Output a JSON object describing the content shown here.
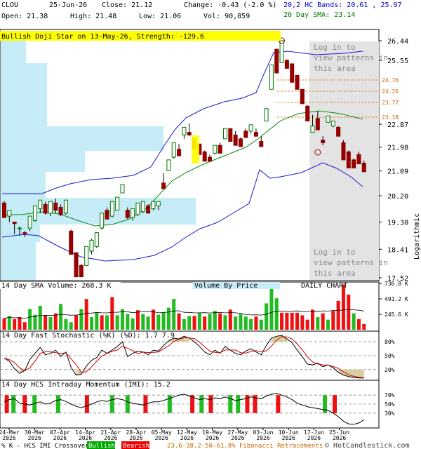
{
  "header": {
    "symbol": "CLOU",
    "date": "25-Jun-26",
    "close_label": "Close: 21.12",
    "change_label": "Change: -0.43 (-2.0 %)",
    "open_label": "Open: 21.38",
    "high_label": "High: 21.48",
    "low_label": "Low: 21.06",
    "vol_label": "Vol: 90,859",
    "bands_label": "20,2 HC Bands: 20.61 , 25.97",
    "sma_label": "20 Day SMA: 23.14"
  },
  "chart_data": {
    "type": "candlestick",
    "pattern_banner": "Bullish Doji Star on 13-May-26, Strength: -129.6",
    "overlay_note": "Log in to view patterns in this area",
    "scale_label": "Logarithmic",
    "price_ticks": [
      "26.44",
      "25.55",
      "22.87",
      "21.98",
      "21.09",
      "20.20",
      "19.30",
      "18.41",
      "17.52"
    ],
    "fib_levels": [
      "24.76",
      "24.26",
      "23.77",
      "23.18"
    ],
    "volume_title": "14 Day SMA Volume: 268.3 K",
    "volume_by_price_label": "Volume By Price",
    "daily_chart_label": "DAILY CHART",
    "volume_ticks": [
      "736.8 K",
      "491.2 K",
      "245.6 K"
    ],
    "stochastic_title": "14 Day Fast Stochastic (%K) (%D): 1.7   7.9",
    "stochastic_ticks": [
      "80%",
      "50%",
      "20%"
    ],
    "imi_title": "14 Day HCS Intraday Momentum (IMI): 15.2",
    "imi_ticks": [
      "70%",
      "50%",
      "30%"
    ],
    "x_dates": [
      [
        "24-Mar",
        "2026"
      ],
      [
        "30-Mar",
        "2026"
      ],
      [
        "07-Apr",
        "2026"
      ],
      [
        "14-Apr",
        "2026"
      ],
      [
        "21-Apr",
        "2026"
      ],
      [
        "28-Apr",
        "2026"
      ],
      [
        "05-May",
        "2026"
      ],
      [
        "12-May",
        "2026"
      ],
      [
        "19-May",
        "2026"
      ],
      [
        "27-May",
        "2026"
      ],
      [
        "03-Jun",
        "2026"
      ],
      [
        "10-Jun",
        "2026"
      ],
      [
        "17-Jun",
        "2026"
      ],
      [
        "25-Jun",
        "2026"
      ]
    ],
    "footer": {
      "crossover": "% K - HCS IMI Crossover:",
      "bullish": "Bullish",
      "bearish": "Bearish",
      "fib": "23.6-38.2-50-61.8% Fibonacci Retracements",
      "copyright": "© HotCandlestick.com"
    },
    "candles": [
      [
        19.95,
        20.02,
        19.5,
        19.45
      ],
      [
        19.5,
        19.65,
        19.3,
        19.7
      ],
      [
        19.3,
        19.2,
        18.9,
        19.25
      ],
      [
        19.1,
        19.15,
        18.85,
        19.1
      ],
      [
        18.95,
        19.0,
        18.8,
        18.9
      ],
      [
        19.1,
        19.35,
        19.0,
        19.5
      ],
      [
        19.35,
        19.8,
        19.3,
        19.85
      ],
      [
        19.75,
        20.0,
        19.6,
        20.05
      ],
      [
        19.9,
        20.0,
        19.55,
        19.6
      ],
      [
        19.6,
        19.95,
        19.5,
        20.0
      ],
      [
        19.95,
        20.1,
        19.6,
        19.7
      ],
      [
        19.8,
        19.9,
        19.5,
        19.55
      ],
      [
        19.6,
        19.95,
        19.55,
        20.05
      ],
      [
        19.0,
        19.05,
        18.3,
        18.25
      ],
      [
        18.3,
        18.3,
        17.65,
        17.55
      ],
      [
        17.9,
        17.95,
        17.6,
        17.55
      ],
      [
        17.9,
        18.45,
        17.9,
        18.5
      ],
      [
        18.35,
        18.75,
        18.25,
        18.7
      ],
      [
        18.5,
        18.9,
        18.45,
        18.95
      ],
      [
        19.1,
        19.55,
        19.05,
        19.6
      ],
      [
        19.7,
        19.8,
        19.45,
        19.4
      ],
      [
        19.5,
        19.95,
        19.45,
        20.0
      ],
      [
        19.7,
        20.05,
        19.7,
        20.15
      ],
      [
        20.3,
        20.5,
        20.35,
        20.6
      ],
      [
        19.7,
        19.8,
        19.4,
        19.45
      ],
      [
        19.45,
        19.7,
        19.35,
        19.75
      ],
      [
        19.55,
        19.85,
        19.5,
        19.95
      ],
      [
        19.65,
        19.95,
        19.6,
        20.0
      ],
      [
        19.85,
        19.9,
        19.7,
        19.6
      ],
      [
        19.75,
        19.95,
        19.7,
        20.0
      ],
      [
        19.85,
        19.95,
        19.7,
        20.0
      ],
      [
        20.65,
        21.0,
        20.5,
        20.45
      ],
      [
        21.1,
        21.45,
        21.1,
        21.5
      ],
      [
        21.6,
        22.1,
        21.55,
        22.15
      ],
      [
        21.9,
        22.1,
        21.7,
        21.65
      ],
      [
        22.45,
        22.7,
        22.3,
        22.75
      ],
      [
        22.55,
        22.9,
        22.4,
        22.45
      ],
      [
        22.3,
        22.35,
        22.0,
        21.9
      ],
      [
        22.1,
        22.05,
        21.7,
        21.7
      ],
      [
        21.8,
        21.85,
        21.5,
        21.45
      ],
      [
        21.6,
        21.7,
        21.5,
        21.45
      ],
      [
        21.75,
        22.0,
        21.7,
        22.05
      ],
      [
        22.05,
        22.15,
        21.85,
        21.75
      ],
      [
        22.3,
        22.6,
        22.4,
        22.7
      ],
      [
        22.7,
        22.65,
        22.25,
        22.2
      ],
      [
        22.45,
        22.6,
        22.1,
        22.05
      ],
      [
        22.3,
        22.35,
        22.1,
        22.0
      ],
      [
        22.6,
        22.7,
        22.4,
        22.35
      ],
      [
        22.6,
        22.75,
        22.5,
        22.85
      ],
      [
        22.55,
        22.7,
        22.45,
        22.4
      ],
      [
        22.2,
        22.4,
        22.15,
        22.0
      ],
      [
        23.0,
        23.35,
        23.1,
        23.5
      ],
      [
        24.3,
        25.1,
        24.4,
        25.35
      ],
      [
        26.05,
        26.05,
        25.1,
        25.0
      ],
      [
        25.45,
        25.7,
        25.55,
        26.44
      ],
      [
        25.55,
        25.6,
        25.2,
        25.2
      ],
      [
        25.4,
        25.4,
        24.9,
        24.6
      ],
      [
        24.9,
        24.65,
        24.4,
        24.3
      ],
      [
        24.3,
        24.1,
        23.85,
        23.7
      ],
      [
        23.6,
        23.65,
        23.25,
        23.0
      ],
      [
        22.55,
        23.25,
        22.55,
        22.8
      ],
      [
        23.1,
        23.4,
        22.9,
        22.65
      ],
      [
        22.25,
        22.4,
        22.05,
        22.15
      ],
      [
        22.95,
        23.2,
        23.0,
        23.2
      ],
      [
        22.8,
        22.85,
        22.75,
        23.0
      ],
      [
        22.75,
        22.8,
        22.45,
        22.4
      ],
      [
        22.15,
        22.25,
        21.55,
        21.5
      ],
      [
        21.8,
        21.85,
        21.35,
        21.2
      ],
      [
        21.5,
        21.55,
        21.3,
        21.2
      ],
      [
        21.7,
        21.8,
        21.4,
        21.35
      ],
      [
        21.38,
        21.48,
        21.12,
        21.06
      ]
    ],
    "volumes": [
      [
        180000,
        "red"
      ],
      [
        220000,
        "green"
      ],
      [
        170000,
        "red"
      ],
      [
        200000,
        "red"
      ],
      [
        120000,
        "red"
      ],
      [
        330000,
        "green"
      ],
      [
        240000,
        "green"
      ],
      [
        380000,
        "green"
      ],
      [
        230000,
        "red"
      ],
      [
        200000,
        "green"
      ],
      [
        260000,
        "red"
      ],
      [
        410000,
        "green"
      ],
      [
        170000,
        "green"
      ],
      [
        120000,
        "green"
      ],
      [
        230000,
        "red"
      ],
      [
        330000,
        "green"
      ],
      [
        490000,
        "red"
      ],
      [
        200000,
        "green"
      ],
      [
        270000,
        "green"
      ],
      [
        230000,
        "red"
      ],
      [
        230000,
        "green"
      ],
      [
        520000,
        "red"
      ],
      [
        230000,
        "green"
      ],
      [
        330000,
        "green"
      ],
      [
        250000,
        "green"
      ],
      [
        180000,
        "green"
      ],
      [
        310000,
        "red"
      ],
      [
        250000,
        "green"
      ],
      [
        210000,
        "green"
      ],
      [
        320000,
        "red"
      ],
      [
        240000,
        "green"
      ],
      [
        280000,
        "green"
      ],
      [
        350000,
        "green"
      ],
      [
        490000,
        "green"
      ],
      [
        260000,
        "red"
      ],
      [
        170000,
        "green"
      ],
      [
        220000,
        "green"
      ],
      [
        220000,
        "red"
      ],
      [
        270000,
        "green"
      ],
      [
        210000,
        "red"
      ],
      [
        250000,
        "green"
      ],
      [
        300000,
        "green"
      ],
      [
        260000,
        "red"
      ],
      [
        230000,
        "green"
      ],
      [
        320000,
        "red"
      ],
      [
        210000,
        "green"
      ],
      [
        250000,
        "green"
      ],
      [
        210000,
        "green"
      ],
      [
        170000,
        "green"
      ],
      [
        210000,
        "red"
      ],
      [
        160000,
        "green"
      ],
      [
        420000,
        "green"
      ],
      [
        660000,
        "green"
      ],
      [
        500000,
        "green"
      ],
      [
        270000,
        "red"
      ],
      [
        270000,
        "red"
      ],
      [
        270000,
        "red"
      ],
      [
        270000,
        "red"
      ],
      [
        230000,
        "red"
      ],
      [
        160000,
        "red"
      ],
      [
        320000,
        "red"
      ],
      [
        200000,
        "green"
      ],
      [
        260000,
        "red"
      ],
      [
        160000,
        "green"
      ],
      [
        300000,
        "red"
      ],
      [
        460000,
        "red"
      ],
      [
        720000,
        "red"
      ],
      [
        560000,
        "red"
      ],
      [
        260000,
        "green"
      ],
      [
        170000,
        "red"
      ],
      [
        90859,
        "red"
      ]
    ],
    "imi_bars": [
      [
        0.5,
        "red"
      ],
      [
        1.8,
        "green"
      ],
      [
        4.0,
        "red"
      ],
      [
        5.9,
        "green"
      ],
      [
        10.5,
        "green"
      ],
      [
        16.1,
        "red"
      ],
      [
        21.0,
        "green"
      ],
      [
        24.0,
        "green"
      ],
      [
        27.5,
        "red"
      ],
      [
        32.2,
        "green"
      ],
      [
        36.6,
        "red"
      ],
      [
        38.4,
        "green"
      ],
      [
        40.2,
        "red"
      ],
      [
        44.0,
        "green"
      ],
      [
        45.5,
        "green"
      ],
      [
        47.3,
        "red"
      ],
      [
        48.8,
        "red"
      ],
      [
        53.3,
        "red"
      ],
      [
        62.4,
        "green"
      ],
      [
        64.3,
        "red"
      ]
    ]
  }
}
